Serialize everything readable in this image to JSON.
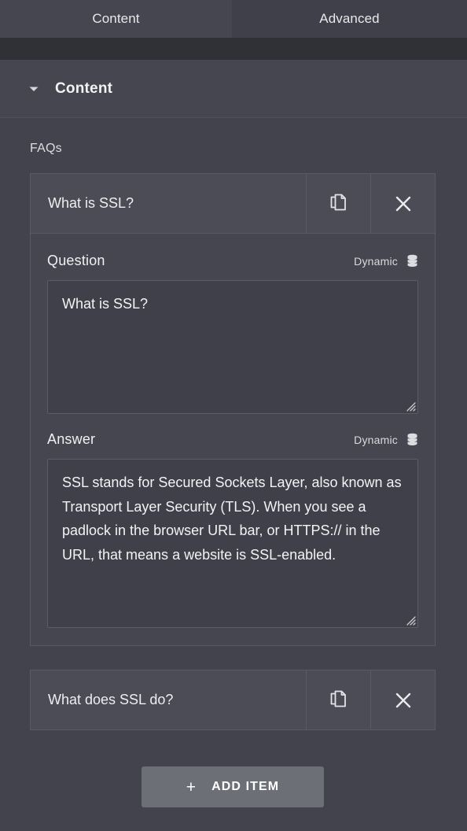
{
  "tabs": [
    {
      "label": "Content",
      "active": true
    },
    {
      "label": "Advanced",
      "active": false
    }
  ],
  "section": {
    "title": "Content",
    "caret_icon": "chevron-down-icon",
    "expanded": true
  },
  "repeater": {
    "field_label": "FAQs",
    "row_duplicate_icon": "duplicate-icon",
    "row_remove_icon": "close-icon",
    "items": [
      {
        "title": "What is SSL?",
        "expanded": true,
        "controls": [
          {
            "title": "Question",
            "dynamic_label": "Dynamic",
            "dynamic_icon": "database-icon",
            "value": "What is SSL?",
            "placeholder": ""
          },
          {
            "title": "Answer",
            "dynamic_label": "Dynamic",
            "dynamic_icon": "database-icon",
            "value": "SSL stands for Secured Sockets Layer, also known as Transport Layer Security (TLS). When you see a padlock in the browser URL bar, or HTTPS:// in the URL, that means a website is SSL-enabled.",
            "placeholder": ""
          }
        ]
      },
      {
        "title": "What does SSL do?",
        "expanded": false,
        "controls": []
      }
    ]
  },
  "add_item": {
    "label": "ADD ITEM",
    "plus_icon": "plus-icon",
    "plus_glyph": "+"
  },
  "colors": {
    "accent": "#71d7f7",
    "page_bg": "#42434d",
    "panel_bg": "#45464f",
    "row_bg": "#4b4c56",
    "input_bg": "#3f4049",
    "border": "#585963",
    "button_bg": "#6d6f76",
    "text": "#f0f1f3",
    "dark_strip": "#303136"
  }
}
